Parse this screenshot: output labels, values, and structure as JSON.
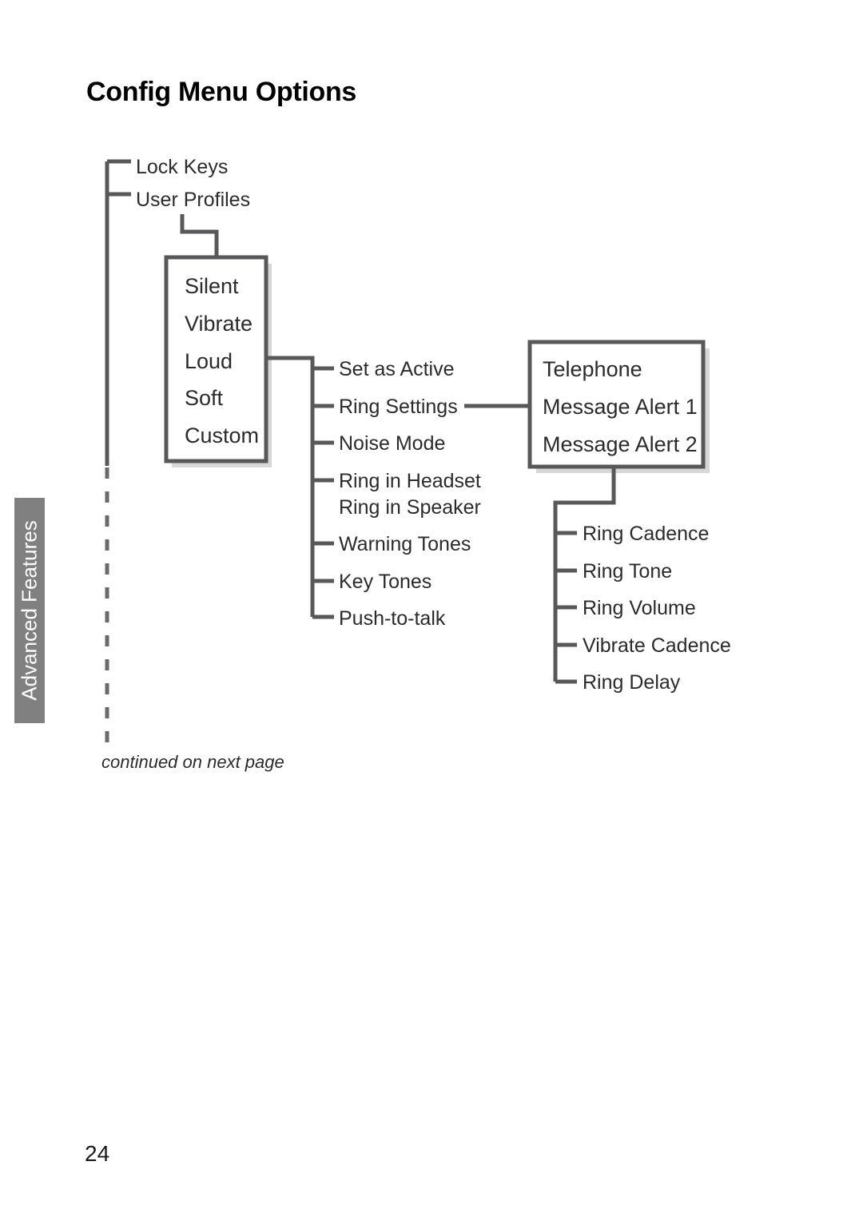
{
  "page": {
    "title": "Config Menu Options",
    "number": "24",
    "continued_note": "continued on next page",
    "side_tab_label": "Advanced Features"
  },
  "colors": {
    "line": "#58585a",
    "box_border": "#58585a",
    "box_shadow": "#d7d7d7",
    "side_tab_bg": "#808080",
    "side_tab_text": "#ffffff",
    "text": "#2b2b2b",
    "title": "#000000"
  },
  "diagram": {
    "type": "tree",
    "root_items": [
      {
        "label": "Lock Keys"
      },
      {
        "label": "User Profiles"
      }
    ],
    "profile_box": {
      "name": "user-profiles-box",
      "items": [
        "Silent",
        "Vibrate",
        "Loud",
        "Soft",
        "Custom"
      ]
    },
    "profile_options": [
      {
        "label": "Set as Active"
      },
      {
        "label": "Ring Settings"
      },
      {
        "label": "Noise Mode"
      },
      {
        "label": "Ring in Headset"
      },
      {
        "label": "Ring in Speaker"
      },
      {
        "label": "Warning Tones"
      },
      {
        "label": "Key Tones"
      },
      {
        "label": "Push-to-talk"
      }
    ],
    "ring_settings_box": {
      "name": "ring-settings-box",
      "items": [
        "Telephone",
        "Message Alert 1",
        "Message Alert 2"
      ]
    },
    "ring_settings_options": [
      {
        "label": "Ring Cadence"
      },
      {
        "label": "Ring Tone"
      },
      {
        "label": "Ring Volume"
      },
      {
        "label": "Vibrate Cadence"
      },
      {
        "label": "Ring Delay"
      }
    ]
  }
}
